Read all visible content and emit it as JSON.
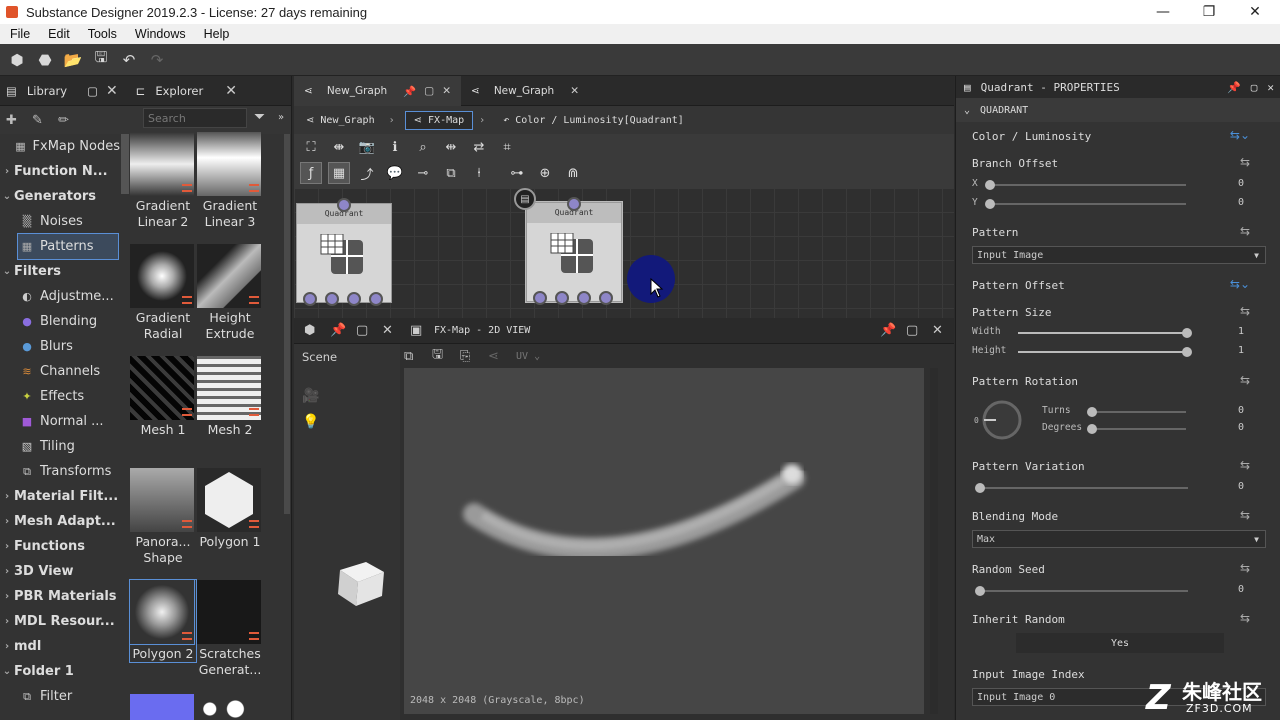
{
  "window": {
    "title": "Substance Designer 2019.2.3 - License: 27 days remaining"
  },
  "menu": [
    "File",
    "Edit",
    "Tools",
    "Windows",
    "Help"
  ],
  "library": {
    "tabs": [
      {
        "label": "Library"
      },
      {
        "label": "Explorer"
      }
    ],
    "search_placeholder": "Search",
    "tree": [
      {
        "label": "FxMap Nodes",
        "level": 0,
        "bold": false,
        "icon": "grid-icon"
      },
      {
        "label": "Function N...",
        "level": 0,
        "bold": true,
        "icon": ""
      },
      {
        "label": "Generators",
        "level": 0,
        "bold": true,
        "icon": ""
      },
      {
        "label": "Noises",
        "level": 1,
        "bold": false,
        "icon": "noise-icon"
      },
      {
        "label": "Patterns",
        "level": 1,
        "bold": false,
        "icon": "pattern-icon",
        "selected": true
      },
      {
        "label": "Filters",
        "level": 0,
        "bold": true,
        "icon": ""
      },
      {
        "label": "Adjustme...",
        "level": 1,
        "bold": false,
        "icon": "adjust-icon"
      },
      {
        "label": "Blending",
        "level": 1,
        "bold": false,
        "icon": "blend-icon"
      },
      {
        "label": "Blurs",
        "level": 1,
        "bold": false,
        "icon": "blur-icon"
      },
      {
        "label": "Channels",
        "level": 1,
        "bold": false,
        "icon": "channels-icon"
      },
      {
        "label": "Effects",
        "level": 1,
        "bold": false,
        "icon": "effects-icon"
      },
      {
        "label": "Normal ...",
        "level": 1,
        "bold": false,
        "icon": "normal-icon"
      },
      {
        "label": "Tiling",
        "level": 1,
        "bold": false,
        "icon": "tiling-icon"
      },
      {
        "label": "Transforms",
        "level": 1,
        "bold": false,
        "icon": "transform-icon"
      },
      {
        "label": "Material Filt...",
        "level": 0,
        "bold": true,
        "icon": ""
      },
      {
        "label": "Mesh Adapt...",
        "level": 0,
        "bold": true,
        "icon": ""
      },
      {
        "label": "Functions",
        "level": 0,
        "bold": true,
        "icon": ""
      },
      {
        "label": "3D View",
        "level": 0,
        "bold": true,
        "icon": ""
      },
      {
        "label": "PBR Materials",
        "level": 0,
        "bold": true,
        "icon": ""
      },
      {
        "label": "MDL Resour...",
        "level": 0,
        "bold": true,
        "icon": ""
      },
      {
        "label": "mdl",
        "level": 0,
        "bold": true,
        "icon": ""
      },
      {
        "label": "Folder 1",
        "level": 0,
        "bold": true,
        "icon": "",
        "expanded": true
      },
      {
        "label": "Filter",
        "level": 1,
        "bold": false,
        "icon": "filter-icon"
      }
    ],
    "thumbs": [
      {
        "caption": "Gradient Linear 2",
        "style": "grad-linear"
      },
      {
        "caption": "Gradient Linear 3",
        "style": "grad-linear3"
      },
      {
        "caption": "Gradient Radial",
        "style": "grad-radial"
      },
      {
        "caption": "Height Extrude",
        "style": "pyramid"
      },
      {
        "caption": "Mesh 1",
        "style": "mesh1"
      },
      {
        "caption": "Mesh 2",
        "style": "mesh2"
      },
      {
        "caption": "Panora... Shape",
        "style": "panorama"
      },
      {
        "caption": "Polygon 1",
        "style": "hexagon"
      },
      {
        "caption": "Polygon 2",
        "style": "hexblur",
        "selected": true
      },
      {
        "caption": "Scratches Generat...",
        "style": "scratches"
      }
    ]
  },
  "graph": {
    "tabs": [
      {
        "label": "New_Graph",
        "active": true
      },
      {
        "label": "New_Graph",
        "active": false
      }
    ],
    "breadcrumb": [
      "New_Graph",
      "FX-Map",
      "Color / Luminosity[Quadrant]"
    ],
    "nodes": [
      {
        "label": "Quadrant"
      },
      {
        "label": "Quadrant"
      }
    ]
  },
  "view2d": {
    "title": "FX-Map - 2D VIEW",
    "scene_label": "Scene",
    "channel": "UV",
    "info": "2048 x 2048 (Grayscale, 8bpc)"
  },
  "properties": {
    "title": "Quadrant - PROPERTIES",
    "section": "QUADRANT",
    "color_luminosity": "Color / Luminosity",
    "branch_offset": {
      "label": "Branch Offset",
      "x_label": "X",
      "y_label": "Y",
      "x": "0",
      "y": "0"
    },
    "pattern": {
      "label": "Pattern",
      "value": "Input Image"
    },
    "pattern_offset": "Pattern  Offset",
    "pattern_size": {
      "label": "Pattern Size",
      "width_label": "Width",
      "height_label": "Height",
      "width": "1",
      "height": "1"
    },
    "pattern_rotation": {
      "label": "Pattern Rotation",
      "turns_label": "Turns",
      "degrees_label": "Degrees",
      "turns": "0",
      "degrees": "0",
      "dial_zero": "0"
    },
    "pattern_variation": {
      "label": "Pattern Variation",
      "value": "0"
    },
    "blending_mode": {
      "label": "Blending Mode",
      "value": "Max"
    },
    "random_seed": {
      "label": "Random Seed",
      "value": "0"
    },
    "inherit_random": {
      "label": "Inherit Random",
      "value": "Yes"
    },
    "input_image_index": {
      "label": "Input Image Index",
      "value": "Input Image 0"
    }
  },
  "watermark": {
    "zh": "朱峰社区",
    "en": "ZF3D.COM"
  },
  "colors": {
    "accent": "#5a8fd6",
    "cursor": "#12197a",
    "pin": "#8e86c8",
    "badge": "#e05a3a"
  }
}
